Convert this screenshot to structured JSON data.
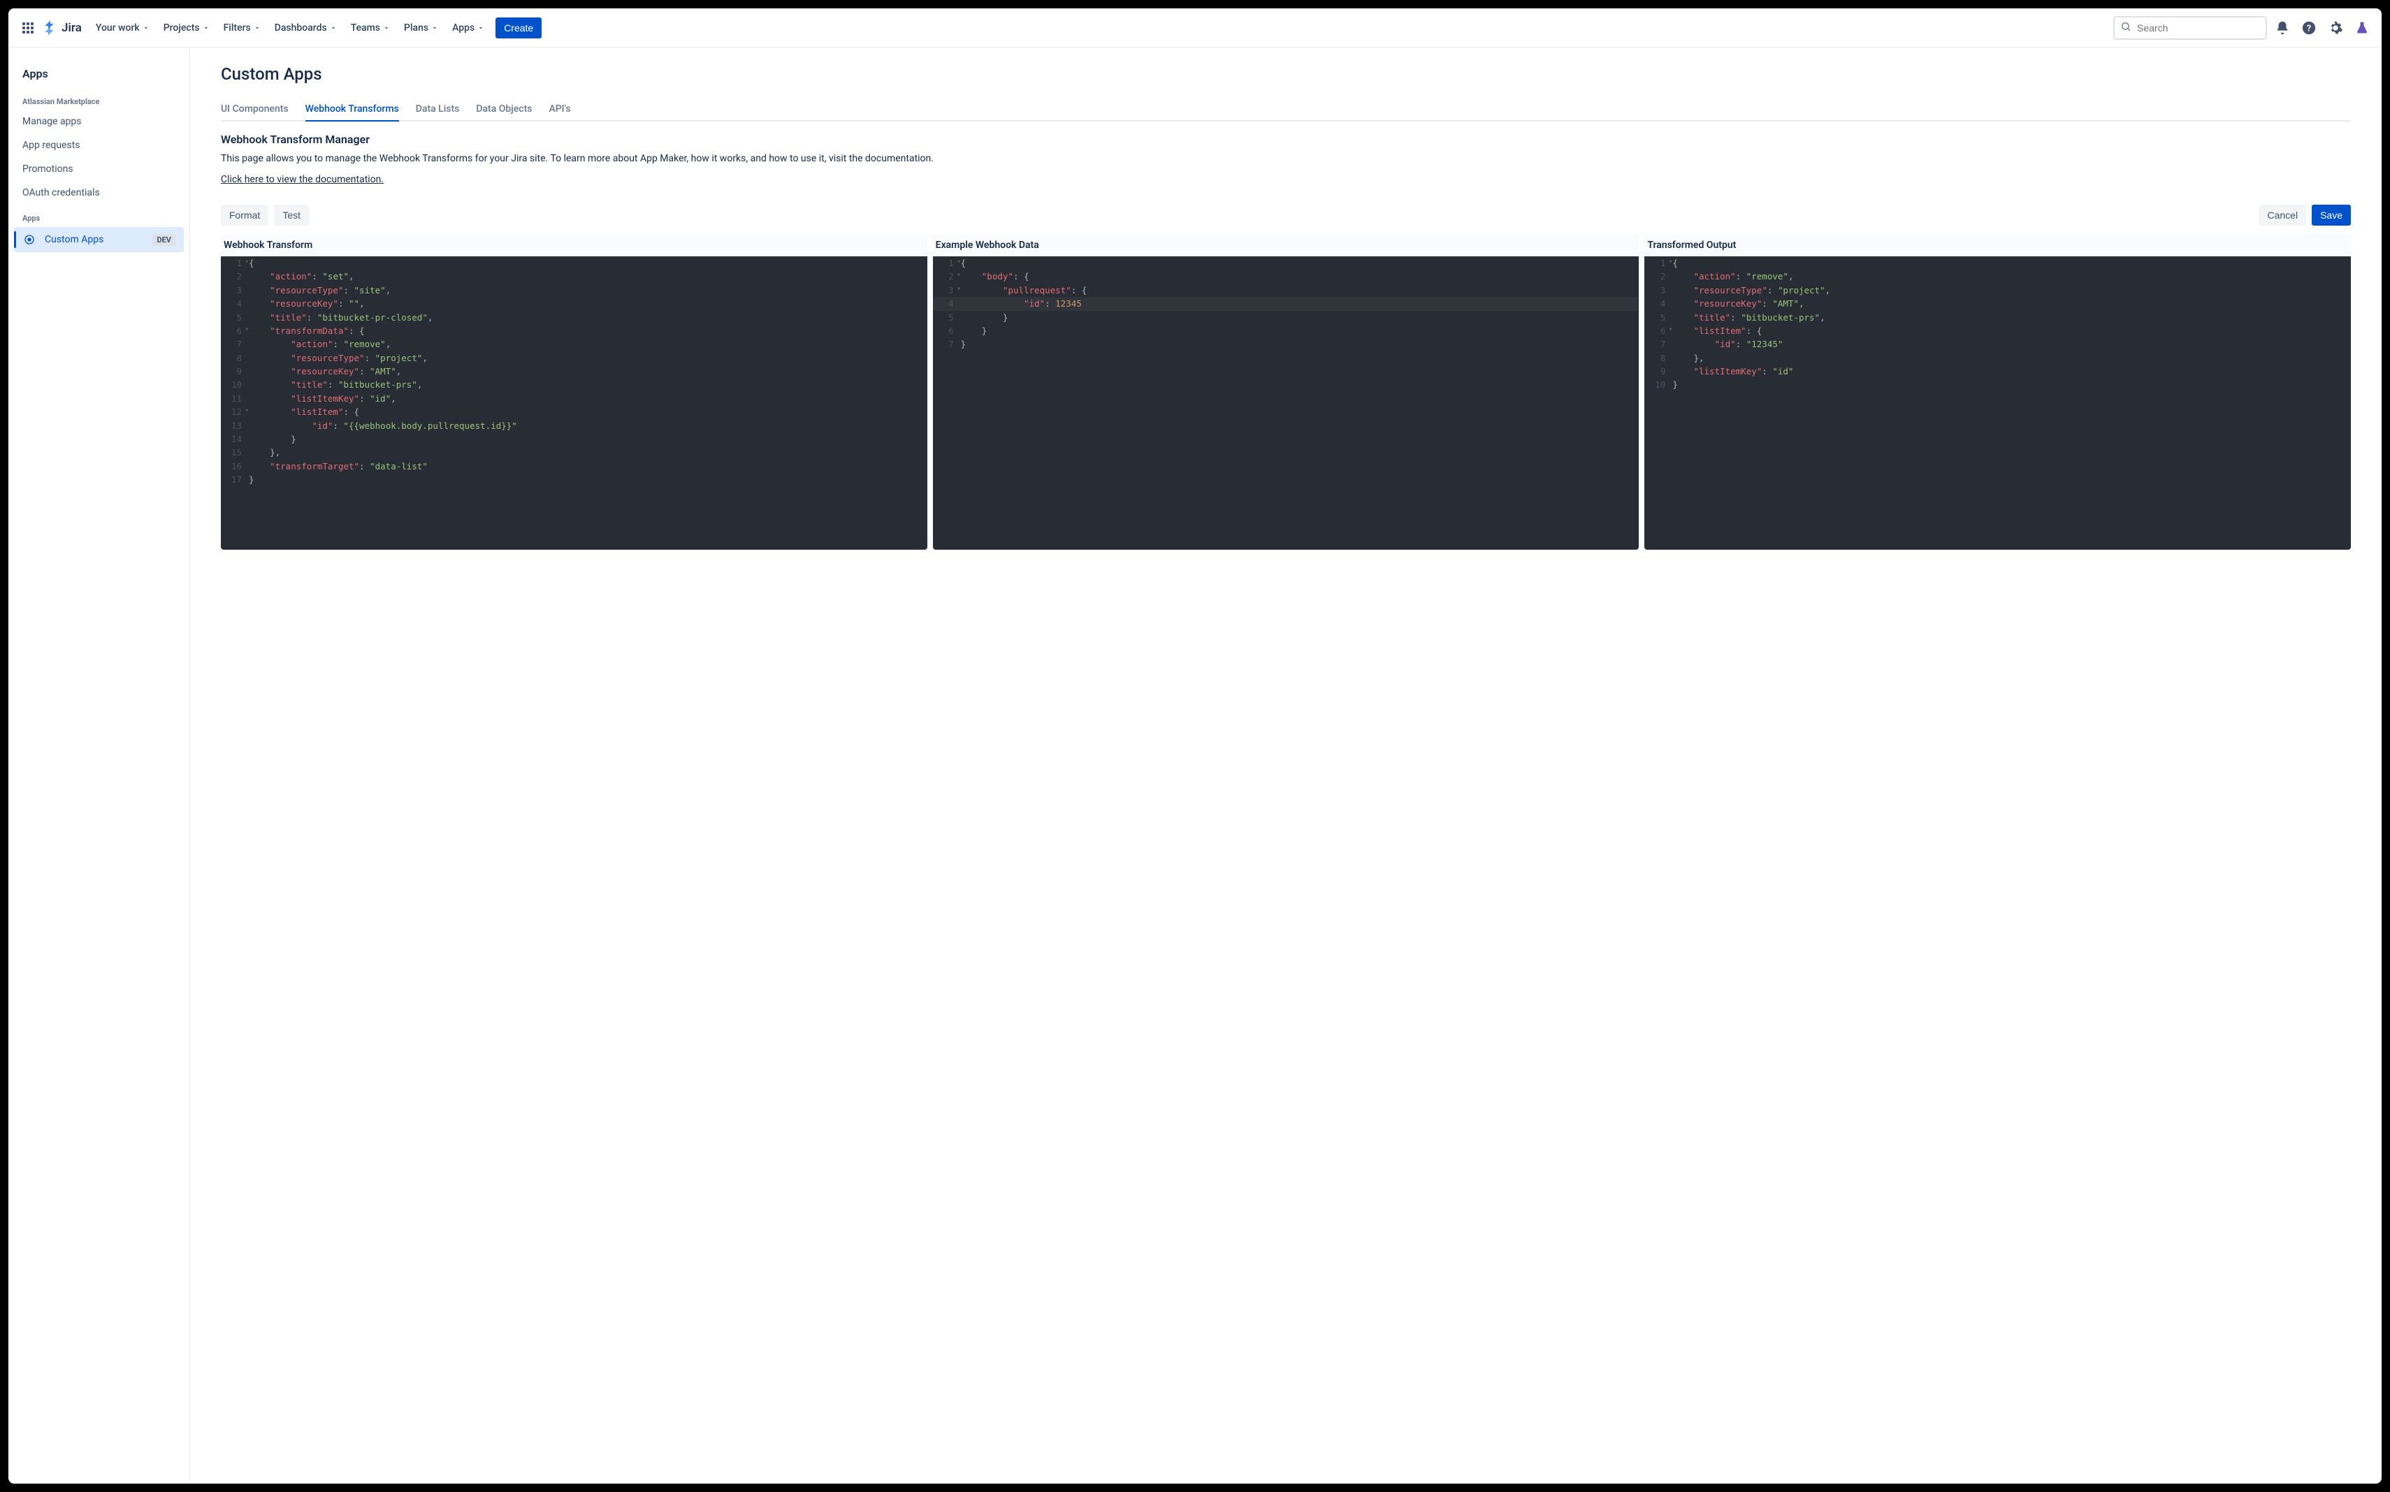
{
  "brand": {
    "name": "Jira"
  },
  "nav": {
    "items": [
      {
        "label": "Your work"
      },
      {
        "label": "Projects"
      },
      {
        "label": "Filters"
      },
      {
        "label": "Dashboards"
      },
      {
        "label": "Teams"
      },
      {
        "label": "Plans"
      },
      {
        "label": "Apps"
      }
    ],
    "create": "Create"
  },
  "search": {
    "placeholder": "Search"
  },
  "sidebar": {
    "title": "Apps",
    "sections": [
      {
        "label": "Atlassian Marketplace",
        "items": [
          {
            "label": "Manage apps"
          },
          {
            "label": "App requests"
          },
          {
            "label": "Promotions"
          },
          {
            "label": "OAuth credentials"
          }
        ]
      },
      {
        "label": "Apps",
        "items": [
          {
            "label": "Custom Apps",
            "active": true,
            "icon": true,
            "badge": "DEV"
          }
        ]
      }
    ]
  },
  "page": {
    "title": "Custom Apps",
    "tabs": [
      {
        "label": "UI Components"
      },
      {
        "label": "Webhook Transforms",
        "active": true
      },
      {
        "label": "Data Lists"
      },
      {
        "label": "Data Objects"
      },
      {
        "label": "API's"
      }
    ],
    "section_title": "Webhook Transform Manager",
    "description": "This page allows you to manage the Webhook Transforms for your Jira site. To learn more about App Maker, how it works, and how to use it, visit the documentation.",
    "doc_link": "Click here to view the documentation.",
    "actions": {
      "format": "Format",
      "test": "Test",
      "cancel": "Cancel",
      "save": "Save"
    },
    "editors": [
      {
        "label": "Webhook Transform",
        "lines": [
          {
            "n": 1,
            "fold": true,
            "t": [
              [
                "p",
                "{"
              ]
            ]
          },
          {
            "n": 2,
            "t": [
              [
                "i",
                "    "
              ],
              [
                "k",
                "\"action\""
              ],
              [
                "p",
                ": "
              ],
              [
                "s",
                "\"set\""
              ],
              [
                "p",
                ","
              ]
            ]
          },
          {
            "n": 3,
            "t": [
              [
                "i",
                "    "
              ],
              [
                "k",
                "\"resourceType\""
              ],
              [
                "p",
                ": "
              ],
              [
                "s",
                "\"site\""
              ],
              [
                "p",
                ","
              ]
            ]
          },
          {
            "n": 4,
            "t": [
              [
                "i",
                "    "
              ],
              [
                "k",
                "\"resourceKey\""
              ],
              [
                "p",
                ": "
              ],
              [
                "s",
                "\"\""
              ],
              [
                "p",
                ","
              ]
            ]
          },
          {
            "n": 5,
            "t": [
              [
                "i",
                "    "
              ],
              [
                "k",
                "\"title\""
              ],
              [
                "p",
                ": "
              ],
              [
                "s",
                "\"bitbucket-pr-closed\""
              ],
              [
                "p",
                ","
              ]
            ]
          },
          {
            "n": 6,
            "fold": true,
            "t": [
              [
                "i",
                "    "
              ],
              [
                "k",
                "\"transformData\""
              ],
              [
                "p",
                ": {"
              ]
            ]
          },
          {
            "n": 7,
            "t": [
              [
                "i",
                "        "
              ],
              [
                "k",
                "\"action\""
              ],
              [
                "p",
                ": "
              ],
              [
                "s",
                "\"remove\""
              ],
              [
                "p",
                ","
              ]
            ]
          },
          {
            "n": 8,
            "t": [
              [
                "i",
                "        "
              ],
              [
                "k",
                "\"resourceType\""
              ],
              [
                "p",
                ": "
              ],
              [
                "s",
                "\"project\""
              ],
              [
                "p",
                ","
              ]
            ]
          },
          {
            "n": 9,
            "t": [
              [
                "i",
                "        "
              ],
              [
                "k",
                "\"resourceKey\""
              ],
              [
                "p",
                ": "
              ],
              [
                "s",
                "\"AMT\""
              ],
              [
                "p",
                ","
              ]
            ]
          },
          {
            "n": 10,
            "t": [
              [
                "i",
                "        "
              ],
              [
                "k",
                "\"title\""
              ],
              [
                "p",
                ": "
              ],
              [
                "s",
                "\"bitbucket-prs\""
              ],
              [
                "p",
                ","
              ]
            ]
          },
          {
            "n": 11,
            "t": [
              [
                "i",
                "        "
              ],
              [
                "k",
                "\"listItemKey\""
              ],
              [
                "p",
                ": "
              ],
              [
                "s",
                "\"id\""
              ],
              [
                "p",
                ","
              ]
            ]
          },
          {
            "n": 12,
            "fold": true,
            "t": [
              [
                "i",
                "        "
              ],
              [
                "k",
                "\"listItem\""
              ],
              [
                "p",
                ": {"
              ]
            ]
          },
          {
            "n": 13,
            "t": [
              [
                "i",
                "            "
              ],
              [
                "k",
                "\"id\""
              ],
              [
                "p",
                ": "
              ],
              [
                "s",
                "\"{{webhook.body.pullrequest.id}}\""
              ]
            ]
          },
          {
            "n": 14,
            "t": [
              [
                "i",
                "        "
              ],
              [
                "p",
                "}"
              ]
            ]
          },
          {
            "n": 15,
            "t": [
              [
                "i",
                "    "
              ],
              [
                "p",
                "},"
              ]
            ]
          },
          {
            "n": 16,
            "t": [
              [
                "i",
                "    "
              ],
              [
                "k",
                "\"transformTarget\""
              ],
              [
                "p",
                ": "
              ],
              [
                "s",
                "\"data-list\""
              ]
            ]
          },
          {
            "n": 17,
            "t": [
              [
                "p",
                "}"
              ]
            ]
          }
        ]
      },
      {
        "label": "Example Webhook Data",
        "lines": [
          {
            "n": 1,
            "fold": true,
            "t": [
              [
                "p",
                "{"
              ]
            ]
          },
          {
            "n": 2,
            "fold": true,
            "t": [
              [
                "i",
                "    "
              ],
              [
                "k",
                "\"body\""
              ],
              [
                "p",
                ": {"
              ]
            ]
          },
          {
            "n": 3,
            "fold": true,
            "t": [
              [
                "i",
                "        "
              ],
              [
                "k",
                "\"pullrequest\""
              ],
              [
                "p",
                ": {"
              ]
            ]
          },
          {
            "n": 4,
            "hl": true,
            "t": [
              [
                "i",
                "            "
              ],
              [
                "k",
                "\"id\""
              ],
              [
                "p",
                ": "
              ],
              [
                "n",
                "12345"
              ]
            ]
          },
          {
            "n": 5,
            "t": [
              [
                "i",
                "        "
              ],
              [
                "p",
                "}"
              ]
            ]
          },
          {
            "n": 6,
            "t": [
              [
                "i",
                "    "
              ],
              [
                "p",
                "}"
              ]
            ]
          },
          {
            "n": 7,
            "t": [
              [
                "p",
                "}"
              ]
            ]
          }
        ]
      },
      {
        "label": "Transformed Output",
        "lines": [
          {
            "n": 1,
            "fold": true,
            "t": [
              [
                "p",
                "{"
              ]
            ]
          },
          {
            "n": 2,
            "t": [
              [
                "i",
                "    "
              ],
              [
                "k",
                "\"action\""
              ],
              [
                "p",
                ": "
              ],
              [
                "s",
                "\"remove\""
              ],
              [
                "p",
                ","
              ]
            ]
          },
          {
            "n": 3,
            "t": [
              [
                "i",
                "    "
              ],
              [
                "k",
                "\"resourceType\""
              ],
              [
                "p",
                ": "
              ],
              [
                "s",
                "\"project\""
              ],
              [
                "p",
                ","
              ]
            ]
          },
          {
            "n": 4,
            "t": [
              [
                "i",
                "    "
              ],
              [
                "k",
                "\"resourceKey\""
              ],
              [
                "p",
                ": "
              ],
              [
                "s",
                "\"AMT\""
              ],
              [
                "p",
                ","
              ]
            ]
          },
          {
            "n": 5,
            "t": [
              [
                "i",
                "    "
              ],
              [
                "k",
                "\"title\""
              ],
              [
                "p",
                ": "
              ],
              [
                "s",
                "\"bitbucket-prs\""
              ],
              [
                "p",
                ","
              ]
            ]
          },
          {
            "n": 6,
            "fold": true,
            "t": [
              [
                "i",
                "    "
              ],
              [
                "k",
                "\"listItem\""
              ],
              [
                "p",
                ": {"
              ]
            ]
          },
          {
            "n": 7,
            "t": [
              [
                "i",
                "        "
              ],
              [
                "k",
                "\"id\""
              ],
              [
                "p",
                ": "
              ],
              [
                "s",
                "\"12345\""
              ]
            ]
          },
          {
            "n": 8,
            "t": [
              [
                "i",
                "    "
              ],
              [
                "p",
                "},"
              ]
            ]
          },
          {
            "n": 9,
            "t": [
              [
                "i",
                "    "
              ],
              [
                "k",
                "\"listItemKey\""
              ],
              [
                "p",
                ": "
              ],
              [
                "s",
                "\"id\""
              ]
            ]
          },
          {
            "n": 10,
            "t": [
              [
                "p",
                "}"
              ]
            ]
          }
        ]
      }
    ]
  }
}
